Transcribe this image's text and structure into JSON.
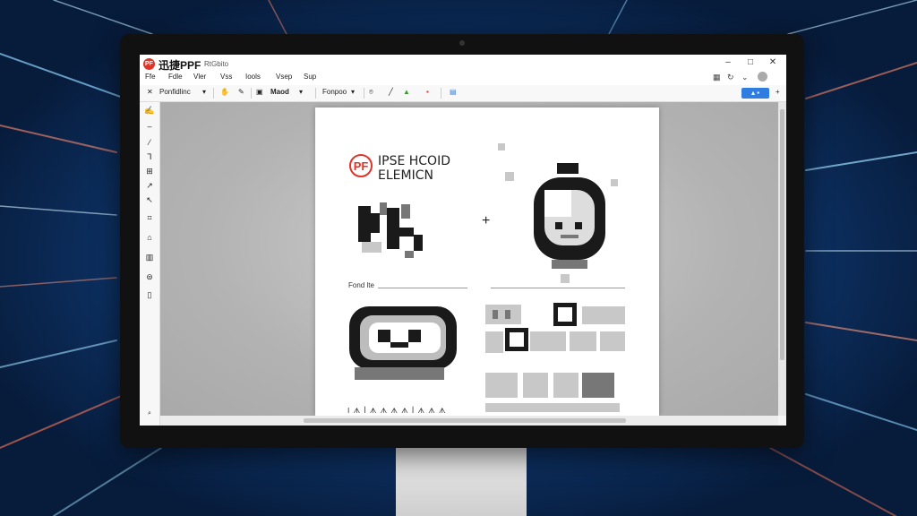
{
  "app": {
    "logo_text": "PF",
    "title": "迅捷PPF",
    "subtitle": "RtGbito"
  },
  "window_controls": {
    "minimize": "–",
    "maximize": "□",
    "close": "✕"
  },
  "menu": {
    "items": [
      "Ffe",
      "Fdle",
      "Vler",
      "Vss",
      "Iools",
      "Vsep",
      "Sup"
    ]
  },
  "toolbar": {
    "mode_label": "Ponfidlinc",
    "view_label": "Maod",
    "zoom_label": "Fonpoo",
    "share_label": "▴ ▪"
  },
  "document": {
    "logo_text": "PF",
    "heading_line1": "IPSE HCOID",
    "heading_line2": "ELEMICN",
    "caption": "Fond  lte",
    "footer_text": "Ⅰ ᗑ ꟾ ᗑ ᗑ ᗑ ᗑ ꟾ ᗑ ᗑ ᗑ"
  },
  "colors": {
    "accent_red": "#e0342a",
    "share_blue": "#2f7de1"
  }
}
